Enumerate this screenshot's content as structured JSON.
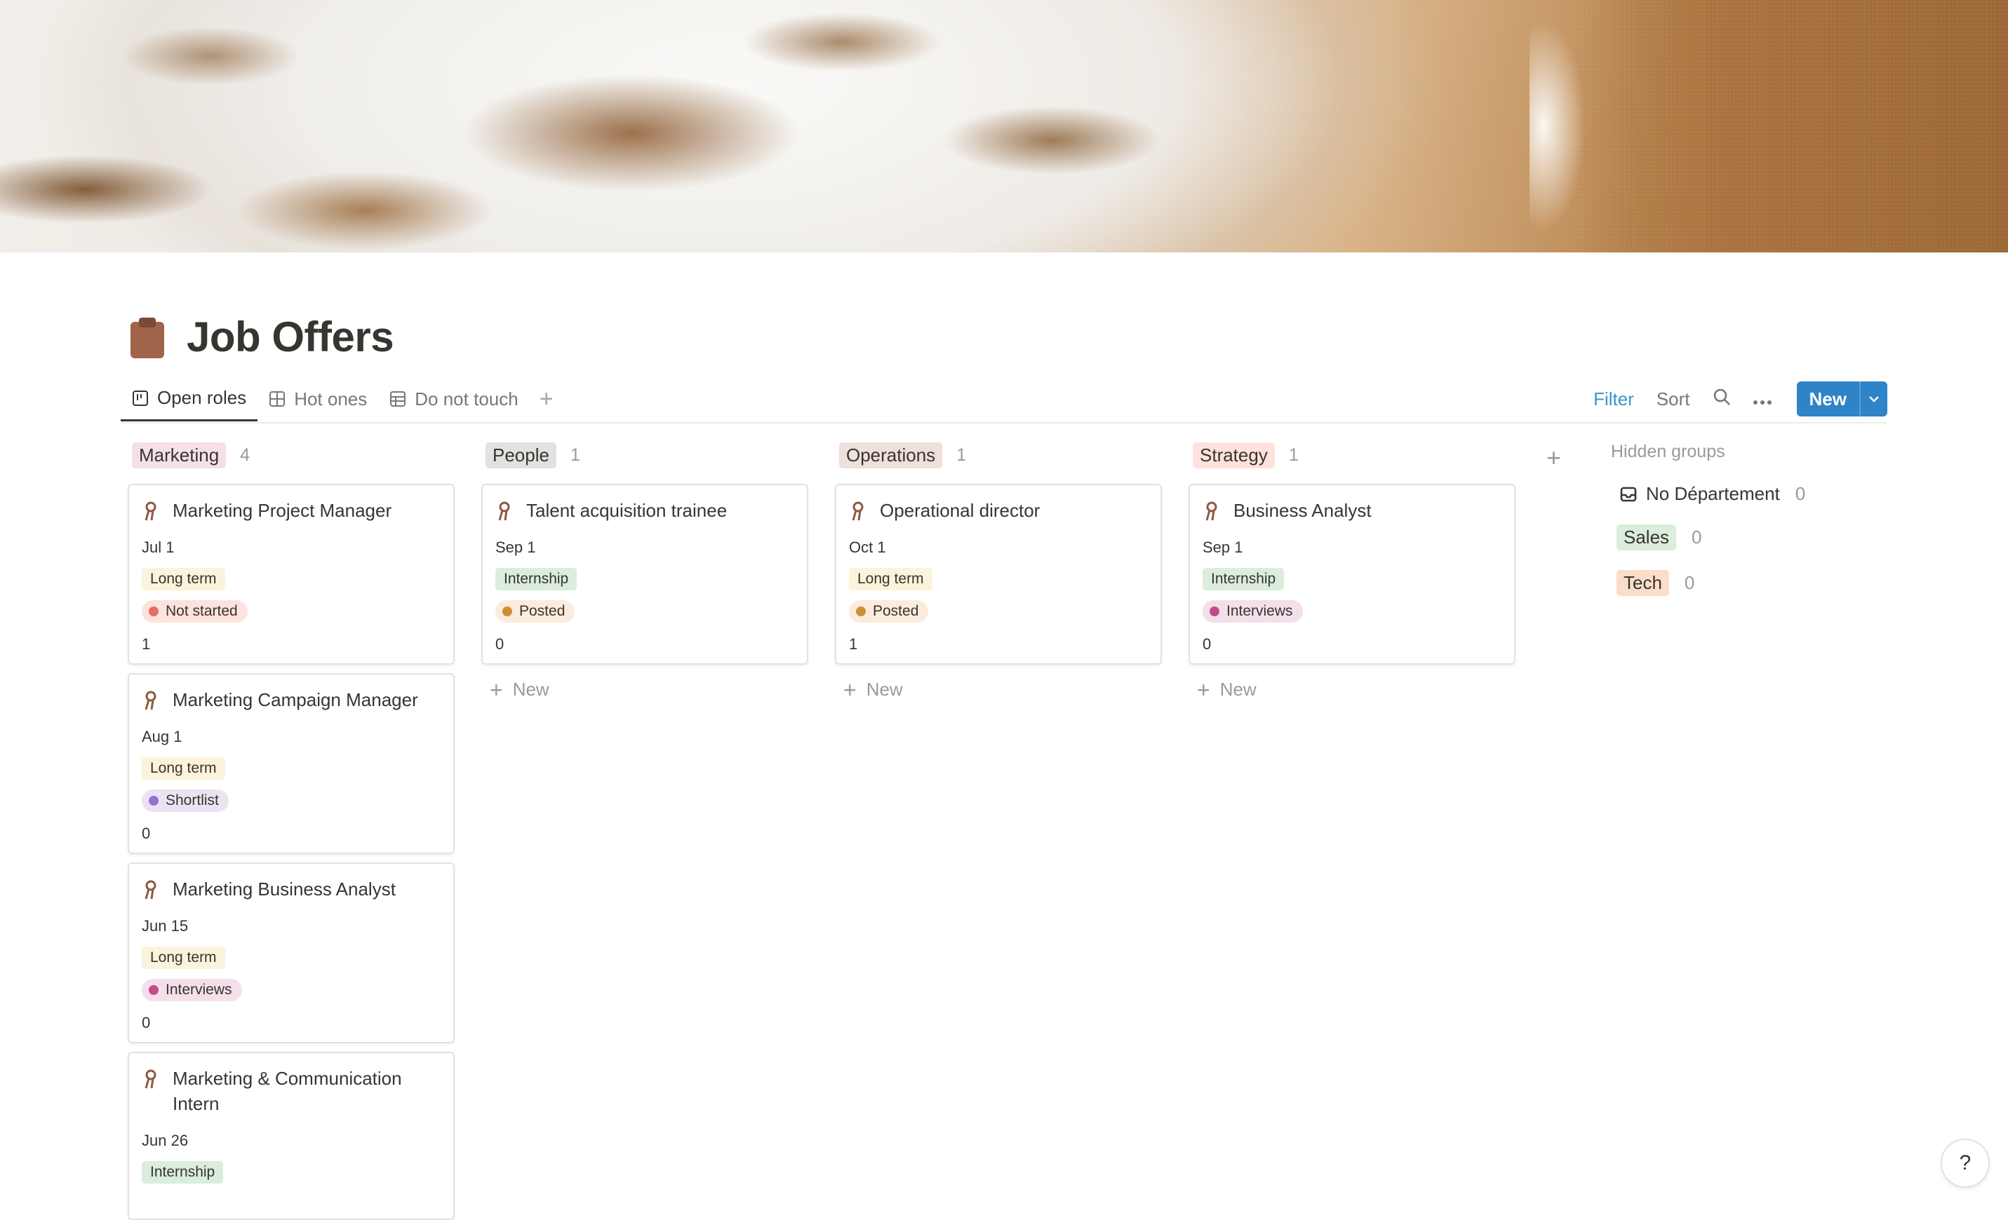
{
  "page": {
    "title": "Job Offers",
    "icon": "clipboard-icon"
  },
  "views": {
    "tabs": [
      {
        "label": "Open roles",
        "icon": "board-view-icon",
        "active": true
      },
      {
        "label": "Hot ones",
        "icon": "gallery-view-icon",
        "active": false
      },
      {
        "label": "Do not touch",
        "icon": "table-view-icon",
        "active": false
      }
    ],
    "add": "+"
  },
  "toolbar": {
    "filter": "Filter",
    "sort": "Sort",
    "search_icon": "search-icon",
    "more_icon": "more-icon",
    "new_label": "New"
  },
  "colors": {
    "accent": "#2f83c7",
    "filter": "#3b96ce"
  },
  "groups": [
    {
      "name": "Marketing",
      "count": "4",
      "color": "#f5e0e9",
      "cards": [
        {
          "title": "Marketing Project Manager",
          "date": "Jul 1",
          "type": "Long term",
          "type_color": "#fbf3db",
          "status": "Not started",
          "status_bg": "#fde2dd",
          "status_dot": "#e16f64",
          "num": "1"
        },
        {
          "title": "Marketing Campaign Manager",
          "date": "Aug 1",
          "type": "Long term",
          "type_color": "#fbf3db",
          "status": "Shortlist",
          "status_bg": "#eae4f2",
          "status_dot": "#9a6dd7",
          "num": "0"
        },
        {
          "title": "Marketing Business Analyst",
          "date": "Jun 15",
          "type": "Long term",
          "type_color": "#fbf3db",
          "status": "Interviews",
          "status_bg": "#f4dfeb",
          "status_dot": "#c14c8a",
          "num": "0"
        },
        {
          "title": "Marketing & Communication Intern",
          "date": "Jun 26",
          "type": "Internship",
          "type_color": "#dbeddb",
          "status": "",
          "status_bg": "",
          "status_dot": "",
          "num": ""
        }
      ]
    },
    {
      "name": "People",
      "count": "1",
      "color": "#e3e2e0",
      "cards": [
        {
          "title": "Talent acquisition trainee",
          "date": "Sep 1",
          "type": "Internship",
          "type_color": "#dbeddb",
          "status": "Posted",
          "status_bg": "#fbecdd",
          "status_dot": "#cb912f",
          "num": "0"
        }
      ],
      "new_label": "New"
    },
    {
      "name": "Operations",
      "count": "1",
      "color": "#eee0da",
      "cards": [
        {
          "title": "Operational director",
          "date": "Oct 1",
          "type": "Long term",
          "type_color": "#fbf3db",
          "status": "Posted",
          "status_bg": "#fbecdd",
          "status_dot": "#cb912f",
          "num": "1"
        }
      ],
      "new_label": "New"
    },
    {
      "name": "Strategy",
      "count": "1",
      "color": "#ffe2dd",
      "cards": [
        {
          "title": "Business Analyst",
          "date": "Sep 1",
          "type": "Internship",
          "type_color": "#dbeddb",
          "status": "Interviews",
          "status_bg": "#f4dfeb",
          "status_dot": "#c14c8a",
          "num": "0"
        }
      ],
      "new_label": "New"
    }
  ],
  "hidden_groups": {
    "title": "Hidden groups",
    "items": [
      {
        "label": "No Département",
        "count": "0",
        "icon": "inbox-icon",
        "bg": ""
      },
      {
        "label": "Sales",
        "count": "0",
        "bg": "#dbeddb"
      },
      {
        "label": "Tech",
        "count": "0",
        "bg": "#fadec9"
      }
    ]
  },
  "help": "?"
}
